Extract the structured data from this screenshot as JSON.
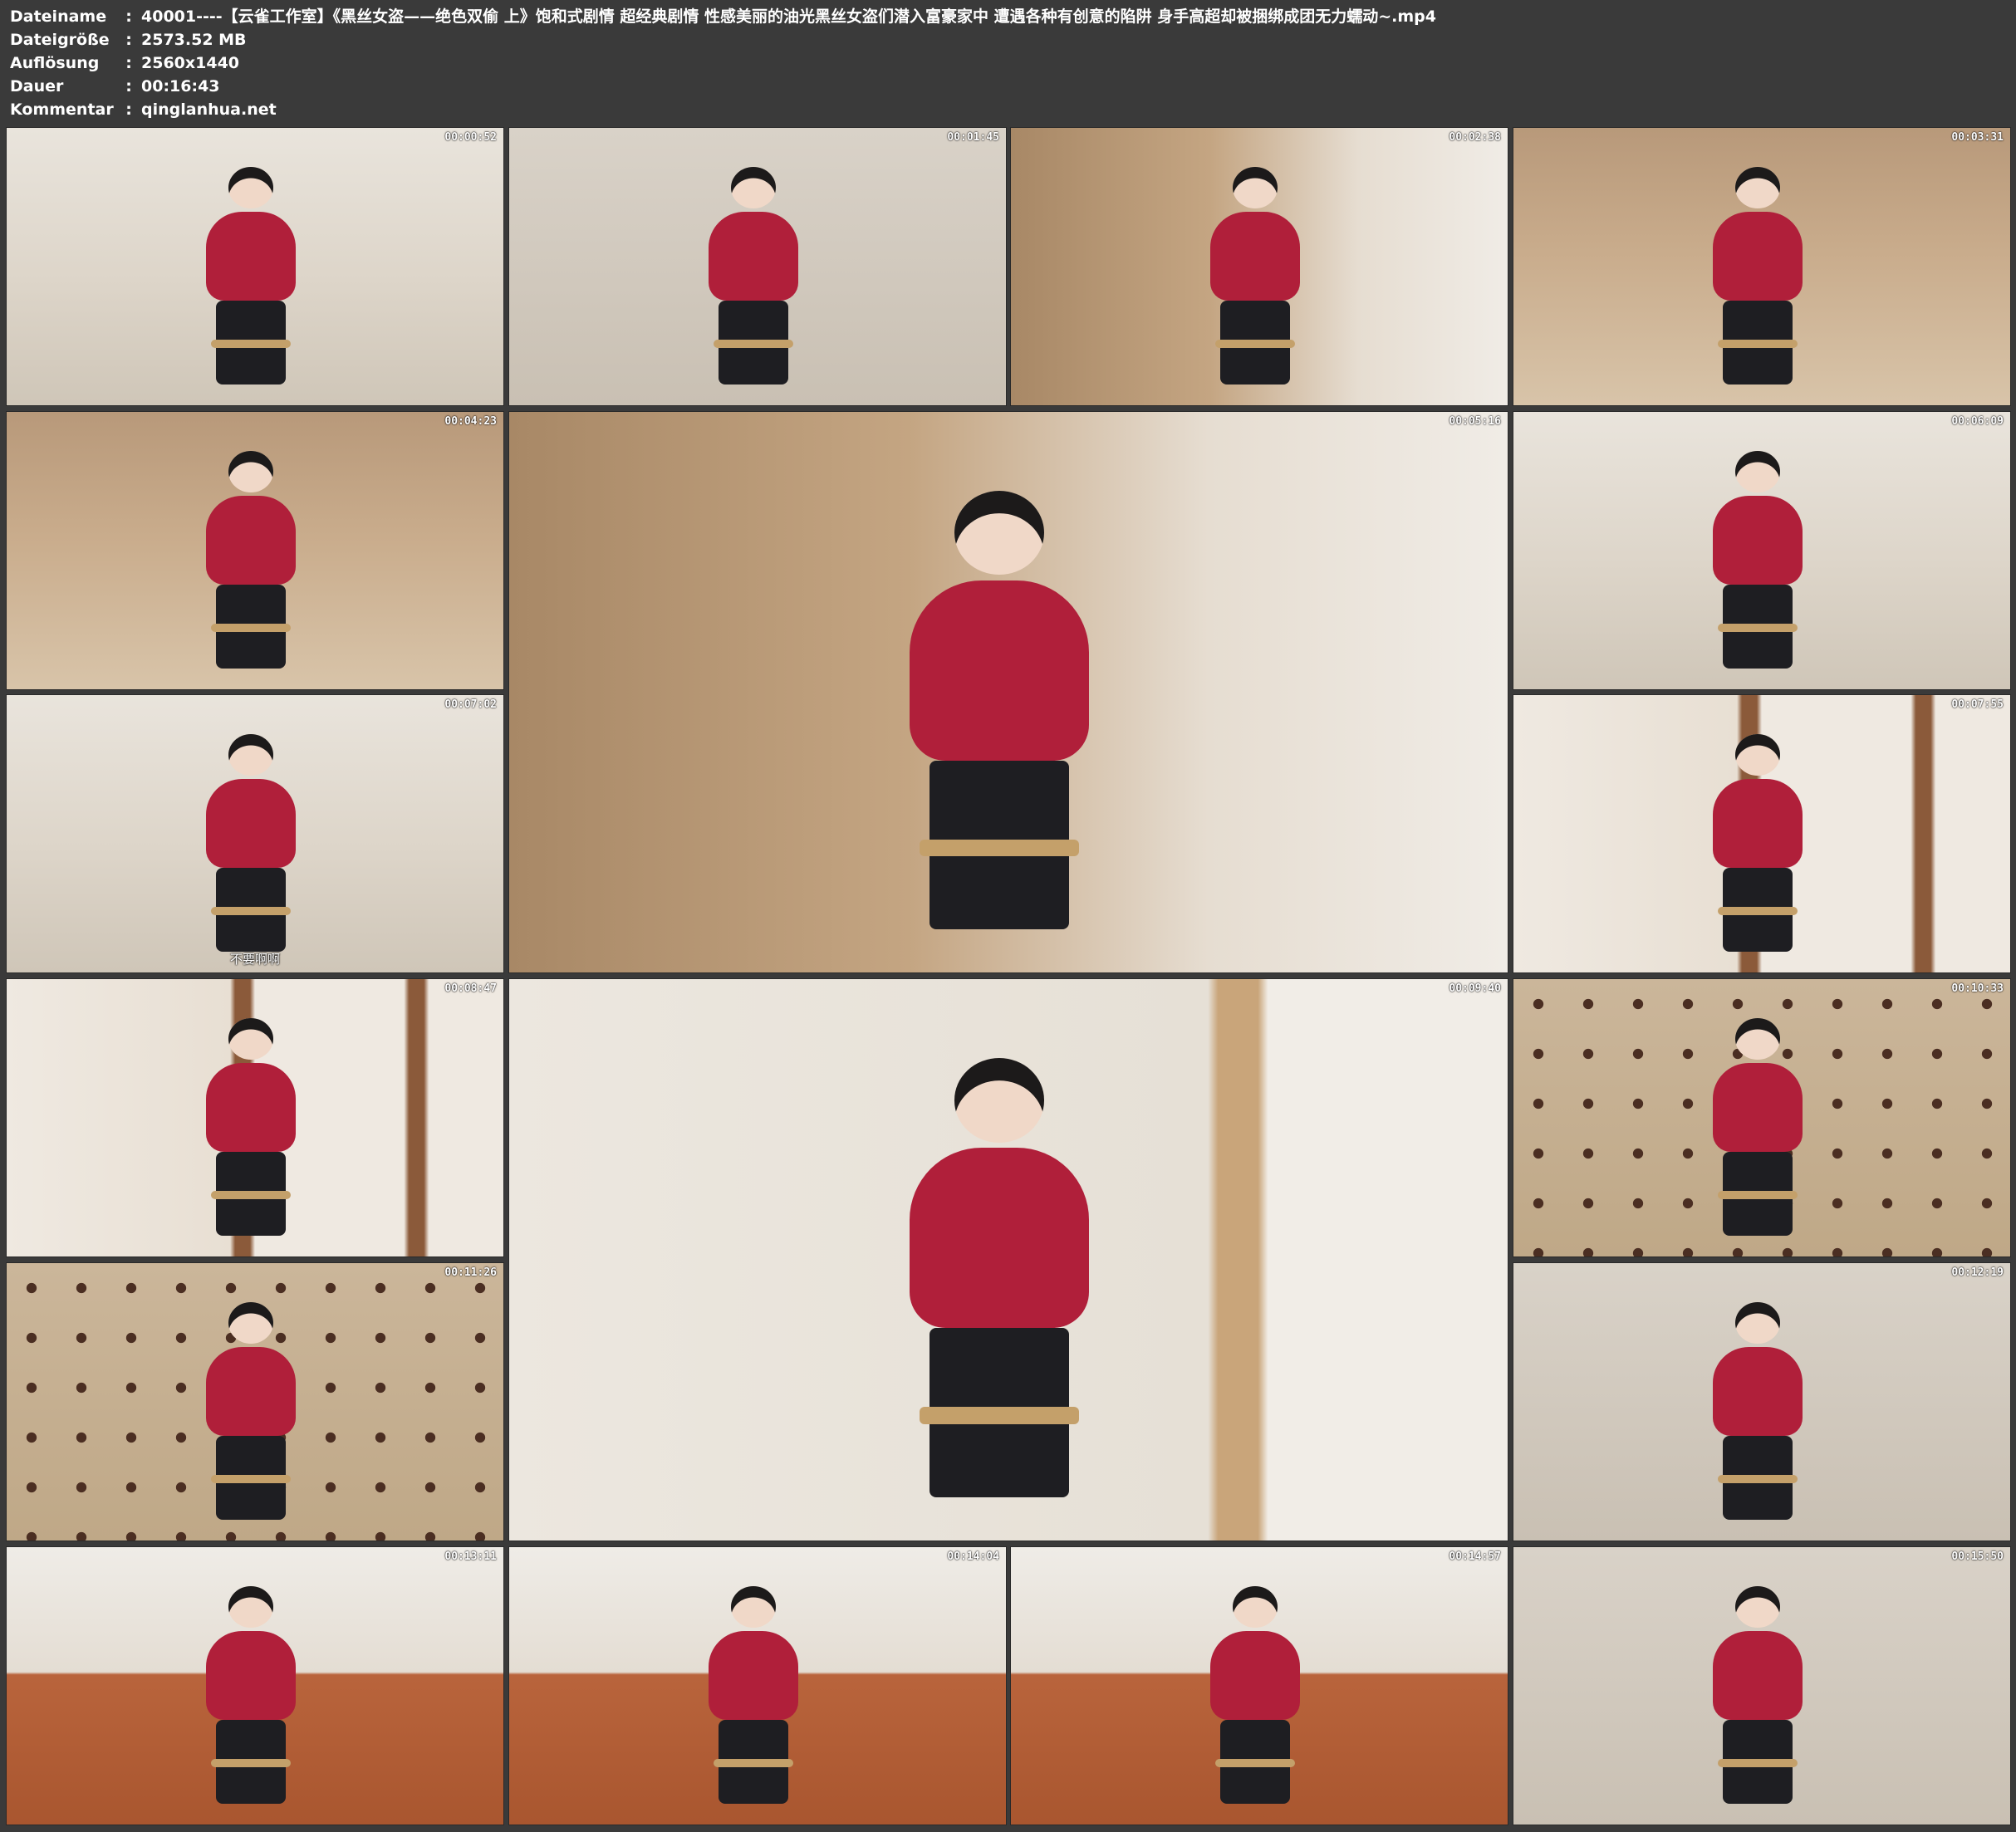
{
  "meta": {
    "rows": [
      {
        "label": "Dateiname",
        "value": "40001----【云雀工作室】《黑丝女盗——绝色双偷 上》饱和式剧情 超经典剧情 性感美丽的油光黑丝女盗们潜入富豪家中 遭遇各种有创意的陷阱 身手高超却被捆绑成团无力蠕动~.mp4"
      },
      {
        "label": "Dateigröße",
        "value": "2573.52 MB"
      },
      {
        "label": "Auflösung",
        "value": "2560x1440"
      },
      {
        "label": "Dauer",
        "value": "00:16:43"
      },
      {
        "label": "Kommentar",
        "value": "qinglanhua.net"
      }
    ],
    "separator": ":"
  },
  "thumbnails": [
    {
      "time": "00:00:52",
      "scene": "bg-room"
    },
    {
      "time": "00:01:45",
      "scene": "bg-floor"
    },
    {
      "time": "00:02:38",
      "scene": "bg-wood"
    },
    {
      "time": "00:03:31",
      "scene": "bg-bed"
    },
    {
      "time": "00:04:23",
      "scene": "bg-bed"
    },
    {
      "time": "00:05:16",
      "scene": "bg-wood"
    },
    {
      "time": "00:06:09",
      "scene": "bg-room"
    },
    {
      "time": "00:07:02",
      "scene": "bg-room",
      "subtitle": "不要啊啊"
    },
    {
      "time": "00:07:55",
      "scene": "bg-shelf"
    },
    {
      "time": "00:08:47",
      "scene": "bg-shelf"
    },
    {
      "time": "00:09:40",
      "scene": "bg-gun"
    },
    {
      "time": "00:10:33",
      "scene": "bg-dots"
    },
    {
      "time": "00:11:26",
      "scene": "bg-dots"
    },
    {
      "time": "00:12:19",
      "scene": "bg-floor"
    },
    {
      "time": "00:13:11",
      "scene": "bg-sofa"
    },
    {
      "time": "00:14:04",
      "scene": "bg-sofa"
    },
    {
      "time": "00:14:57",
      "scene": "bg-sofa"
    },
    {
      "time": "00:15:50",
      "scene": "bg-floor"
    }
  ]
}
